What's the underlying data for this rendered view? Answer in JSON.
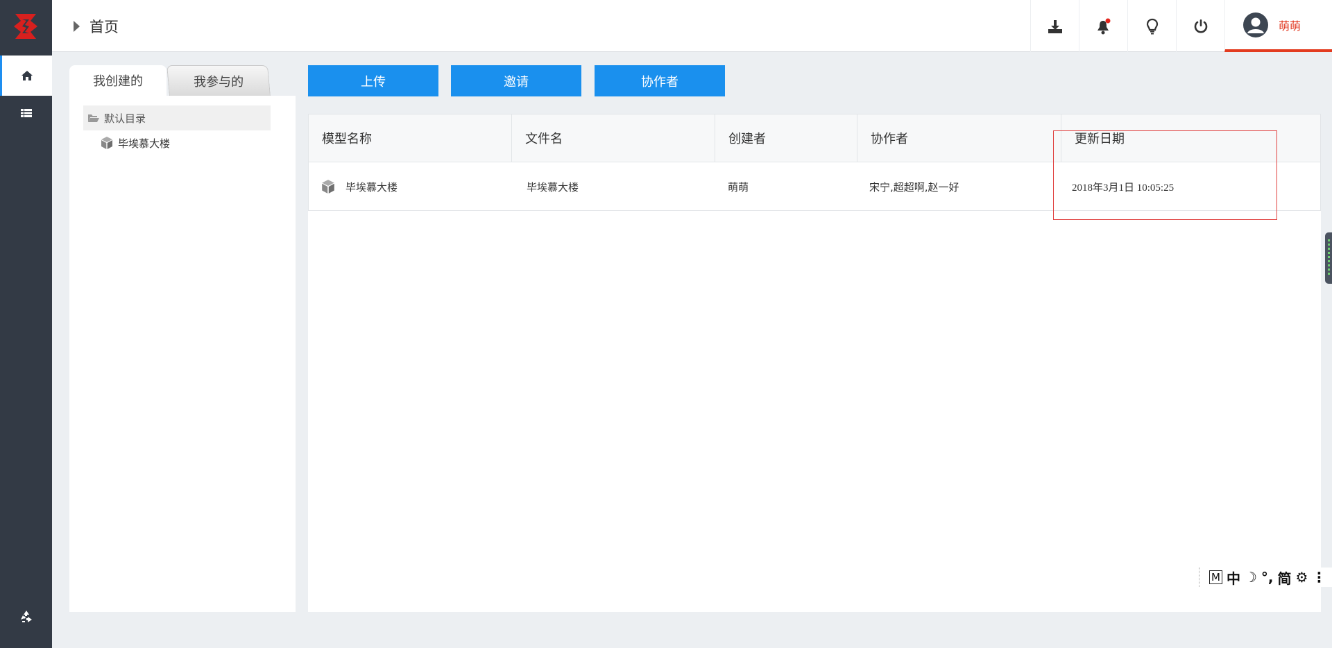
{
  "header": {
    "breadcrumb": "首页",
    "user_name": "萌萌"
  },
  "colors": {
    "sidebar": "#333a45",
    "primary": "#1a90ee",
    "user_accent": "#e33b1f",
    "highlight": "#e0403f"
  },
  "tabs": [
    {
      "label": "我创建的"
    },
    {
      "label": "我参与的"
    }
  ],
  "tree": {
    "folder": "默认目录",
    "item": "毕埃慕大楼"
  },
  "actions": {
    "upload": "上传",
    "invite": "邀请",
    "collaborators": "协作者"
  },
  "table": {
    "headers": [
      "模型名称",
      "文件名",
      "创建者",
      "协作者",
      "更新日期"
    ],
    "rows": [
      {
        "model": "毕埃慕大楼",
        "file": "毕埃慕大楼",
        "creator": "萌萌",
        "collaborators": "宋宁,超超啊,赵一好",
        "updated": "2018年3月1日 10:05:25"
      }
    ]
  },
  "ime": {
    "m": "M",
    "lang": "中",
    "moon": "☽",
    "punct": "°,",
    "simp": "简",
    "gear": "⚙",
    "more": "⋮"
  }
}
